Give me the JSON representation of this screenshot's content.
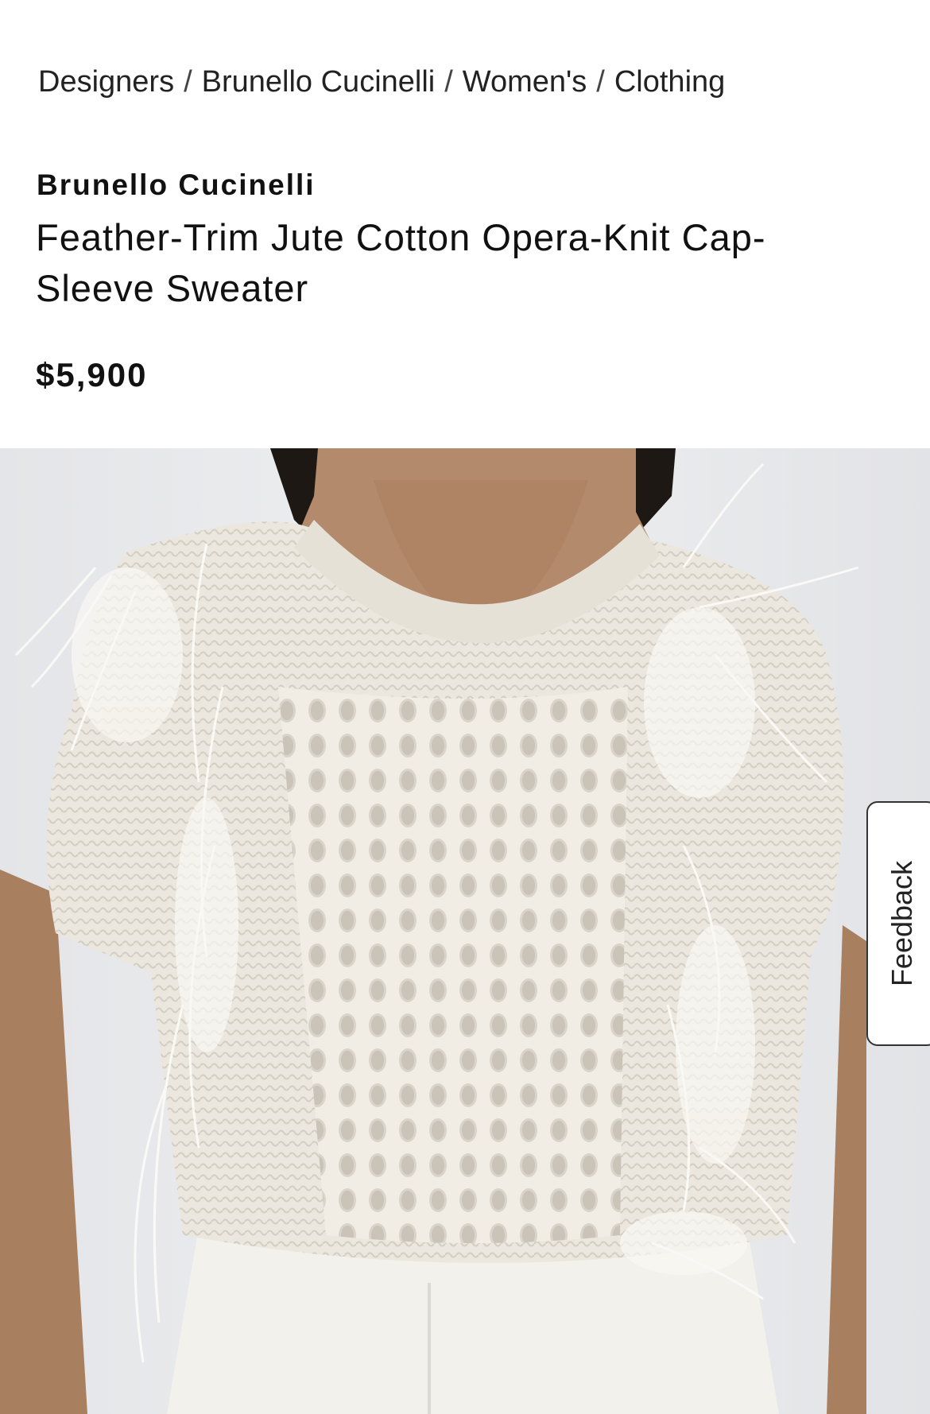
{
  "breadcrumb": {
    "items": [
      {
        "label": "Designers"
      },
      {
        "label": "Brunello Cucinelli"
      },
      {
        "label": "Women's"
      },
      {
        "label": "Clothing"
      }
    ],
    "separator": "/"
  },
  "product": {
    "brand": "Brunello Cucinelli",
    "name": "Feather-Trim Jute Cotton Opera-Knit Cap-Sleeve Sweater",
    "price": "$5,900",
    "image_subject": "sweater-photo"
  },
  "feedback": {
    "label": "Feedback"
  },
  "colors": {
    "text": "#111111",
    "background": "#ffffff",
    "photo_background": "#e9eaec",
    "knit": "#ece8df",
    "skin": "#b48a6c",
    "hair": "#1e1815"
  }
}
